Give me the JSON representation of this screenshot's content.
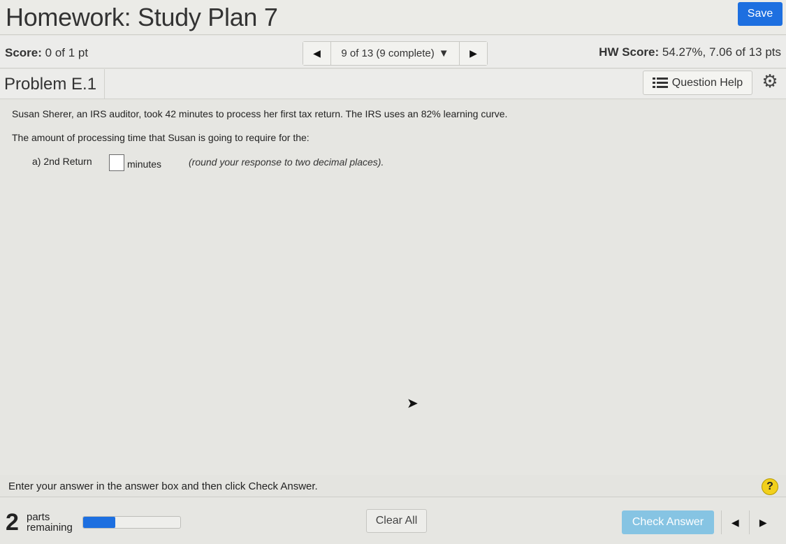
{
  "header": {
    "title": "Homework: Study Plan 7",
    "save_label": "Save"
  },
  "scorebar": {
    "score_label": "Score:",
    "score_value": "0 of 1 pt",
    "nav_position": "9 of 13 (9 complete)",
    "hw_score_label": "HW Score:",
    "hw_score_value": "54.27%, 7.06 of 13 pts"
  },
  "problem": {
    "title": "Problem E.1",
    "question_help_label": "Question Help",
    "text_1": "Susan Sherer, an IRS auditor, took 42 minutes to process her first tax return. The IRS uses an 82% learning curve.",
    "text_2": "The amount of processing time that Susan is going to require for the:",
    "part_label": "a) 2nd Return",
    "answer_value": "",
    "unit": "minutes",
    "hint": "(round your response to two decimal places)."
  },
  "instruction": {
    "text": "Enter your answer in the answer box and then click Check Answer.",
    "help_symbol": "?"
  },
  "footer": {
    "parts_count": "2",
    "parts_word_1": "parts",
    "parts_word_2": "remaining",
    "progress_fraction": 0.33,
    "clear_label": "Clear All",
    "check_label": "Check Answer"
  },
  "icons": {
    "prev": "triangle-left",
    "next": "triangle-right",
    "dropdown": "triangle-down",
    "list": "list-icon",
    "gear": "gear-icon"
  },
  "colors": {
    "save_button": "#1d6fe0",
    "check_button": "#86c4e3",
    "progress_fill": "#1d6fe0",
    "help_circle": "#f2d01c"
  }
}
